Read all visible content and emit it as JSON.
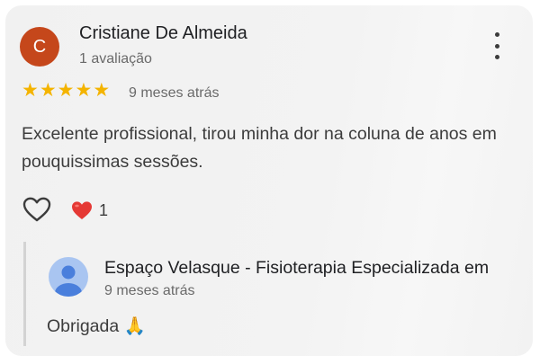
{
  "review": {
    "author_initial": "C",
    "author_name": "Cristiane De Almeida",
    "author_meta": "1 avaliação",
    "rating": 5,
    "stars": [
      "★",
      "★",
      "★",
      "★",
      "★"
    ],
    "time": "9 meses atrás",
    "text": "Excelente profissional, tirou minha dor na coluna de anos em pouquissimas sessões.",
    "reaction_count": "1"
  },
  "reply": {
    "owner_name": "Espaço Velasque - Fisioterapia Especializada em",
    "time": "9 meses atrás",
    "text": "Obrigada 🙏"
  },
  "icons": {
    "more": "more-vert-icon",
    "like": "heart-outline-icon",
    "reaction": "red-heart-icon",
    "owner": "person-avatar-icon"
  },
  "colors": {
    "avatar": "#c5471b",
    "star": "#f4b400",
    "reaction_heart": "#e53935",
    "owner_avatar_bg": "#a9c5f1",
    "owner_avatar_fg": "#4a7fdc"
  }
}
